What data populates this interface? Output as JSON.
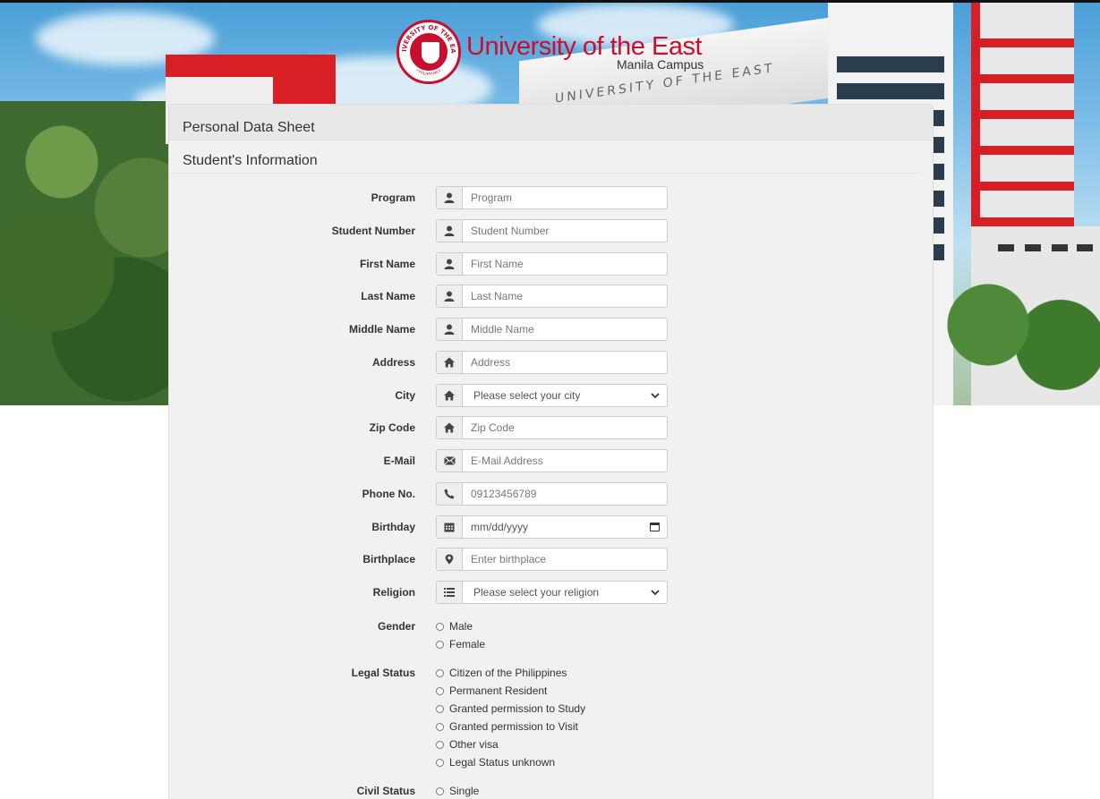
{
  "brand": {
    "title": "University of the East",
    "subtitle": "Manila Campus",
    "seal_text": "UNIVERSITY OF THE EAST",
    "seal_bottom": "PHILIPPINES",
    "building_sign": "UNIVERSITY OF THE EAST"
  },
  "panel": {
    "title": "Personal Data Sheet",
    "section": "Student's Information"
  },
  "fields": {
    "program": {
      "label": "Program",
      "placeholder": "Program",
      "icon": "user-icon"
    },
    "student_number": {
      "label": "Student Number",
      "placeholder": "Student Number",
      "icon": "user-icon"
    },
    "first_name": {
      "label": "First Name",
      "placeholder": "First Name",
      "icon": "user-icon"
    },
    "last_name": {
      "label": "Last Name",
      "placeholder": "Last Name",
      "icon": "user-icon"
    },
    "middle_name": {
      "label": "Middle Name",
      "placeholder": "Middle Name",
      "icon": "user-icon"
    },
    "address": {
      "label": "Address",
      "placeholder": "Address",
      "icon": "home-icon"
    },
    "city": {
      "label": "City",
      "selected": "Please select your city",
      "icon": "home-icon"
    },
    "zip": {
      "label": "Zip Code",
      "placeholder": "Zip Code",
      "icon": "home-icon"
    },
    "email": {
      "label": "E-Mail",
      "placeholder": "E-Mail Address",
      "icon": "envelope-icon"
    },
    "phone": {
      "label": "Phone No.",
      "placeholder": "09123456789",
      "icon": "phone-icon"
    },
    "birthday": {
      "label": "Birthday",
      "placeholder": "mm/dd/yyyy",
      "icon": "calendar-icon"
    },
    "birthplace": {
      "label": "Birthplace",
      "placeholder": "Enter birthplace",
      "icon": "map-marker-icon"
    },
    "religion": {
      "label": "Religion",
      "selected": "Please select your religion",
      "icon": "list-icon"
    }
  },
  "gender": {
    "label": "Gender",
    "options": [
      "Male",
      "Female"
    ]
  },
  "legal_status": {
    "label": "Legal Status",
    "options": [
      "Citizen of the Philippines",
      "Permanent Resident",
      "Granted permission to Study",
      "Granted permission to Visit",
      "Other visa",
      "Legal Status unknown"
    ]
  },
  "civil_status": {
    "label": "Civil Status",
    "options": [
      "Single"
    ]
  },
  "colors": {
    "brand_red": "#c8102e",
    "panel_bg": "#f1f1f1"
  }
}
